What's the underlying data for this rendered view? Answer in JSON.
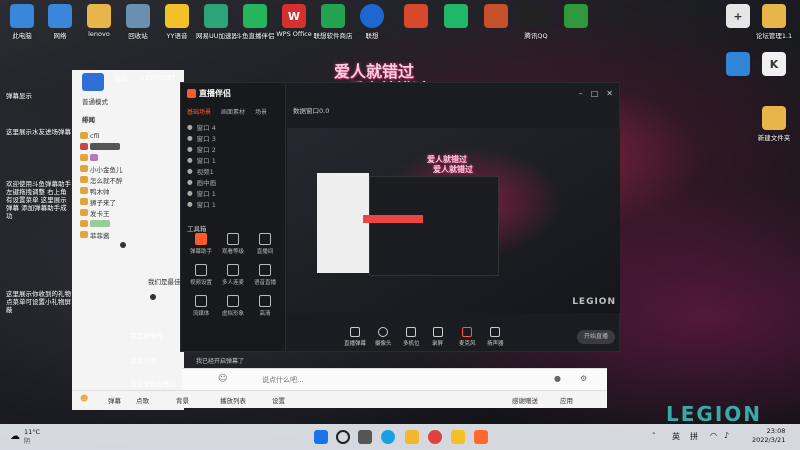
{
  "desktop_left": [
    {
      "label": "此电脑",
      "color": "#3a86d8"
    },
    {
      "label": "网络",
      "color": "#3a86d8"
    },
    {
      "label": "lenovo",
      "color": "#e8b54a"
    },
    {
      "label": "回收站",
      "color": "#6b8fb0"
    },
    {
      "label": "YY语音",
      "color": "#f2c128"
    },
    {
      "label": "网易UU加速器",
      "color": "#2ca47a"
    },
    {
      "label": "斗鱼直播伴侣",
      "color": "#27b55b"
    },
    {
      "label": "WPS Office",
      "color": "#d62f2f"
    },
    {
      "label": "联想软件商店",
      "color": "#22a34f"
    },
    {
      "label": "联想",
      "color": "#1e67d3"
    },
    {
      "label": "",
      "color": "#d8492b"
    },
    {
      "label": "",
      "color": "#20b868"
    },
    {
      "label": "",
      "color": "#c7512b"
    },
    {
      "label": "腾讯QQ",
      "color": "#222222"
    },
    {
      "label": "",
      "color": "#2f9a3c"
    }
  ],
  "desktop_right": [
    {
      "label": "",
      "color": "#e6e6e6"
    },
    {
      "label": "论坛管理1.1",
      "color": "#e8b54a"
    },
    {
      "label": "",
      "color": "#2f86d8"
    },
    {
      "label": "",
      "color": "#f0f0f0"
    },
    {
      "label": "新建文件夹",
      "color": "#e8b54a"
    }
  ],
  "overlay": {
    "line1": "爱人就错过",
    "line2": "爱人就错过",
    "inner1": "爱人就错过",
    "inner2": "爱人就错过"
  },
  "chat_panel": {
    "header_name": "绯闻.",
    "header_id": "13306287",
    "mode_label": "普通模式",
    "group_label": "绯闻",
    "users": [
      "cfll",
      " ",
      "",
      "小小金鱼儿",
      "怎么就不醉",
      "鸭木帅",
      "狮子来了",
      "发卡王",
      "",
      "菲菲酱"
    ],
    "bottom_label": "我们是最佳"
  },
  "side_text": {
    "label_top": "弹幕显示",
    "text_a": "这里展示水友进场弹幕",
    "text_b": "欢迎使用斗鱼弹幕助手 左键拖拽调整 右上角有设置菜单 这里展示弹幕 添加弹幕助手成功",
    "text_c": "这里展示你收到的礼物 点菜单可设置小礼物屏蔽"
  },
  "app": {
    "title": "直播伴侣",
    "tabs": [
      "基础场景",
      "画面素材",
      "场景"
    ],
    "scenes": [
      "窗口 4",
      "窗口 3",
      "窗口 2",
      "窗口 1",
      "视频1",
      "画中画",
      "窗口 1",
      "窗口 1"
    ],
    "toolbox_label": "工具箱",
    "tools": [
      "弹幕助手",
      "观看等级",
      "直播间",
      "视频设置",
      "多人连麦",
      "语音直播",
      "流媒体",
      "虚拟形象",
      "高清",
      "",
      "",
      ""
    ],
    "preview_top_label": "数据窗口0.0",
    "bottom_buttons": [
      "直播弹幕",
      "摄像头",
      "多机位",
      "录屏",
      "麦克风",
      "扬声器"
    ],
    "start_label": "开始直播",
    "watermark": "LEGION"
  },
  "chat_messages": [
    {
      "text": "我是新来的",
      "label": ""
    },
    {
      "text": "关注了你",
      "label": ""
    },
    {
      "text": "欢迎来到直播间",
      "label": ""
    }
  ],
  "bottom_notice": "我已经开启弹幕了",
  "chat_input": {
    "placeholder": "说点什么吧..."
  },
  "bottom_toolbar": {
    "items": [
      "弹幕",
      "点歌",
      "背景",
      "播放列表",
      "设置"
    ],
    "right_label": "感谢赠送",
    "right_label2": "应用"
  },
  "taskbar": {
    "weather_temp": "11°C",
    "weather_desc": "阴",
    "lang": "英",
    "ime": "拼",
    "time": "23:08",
    "date": "2022/3/21"
  },
  "legion_logo": "LEGION"
}
